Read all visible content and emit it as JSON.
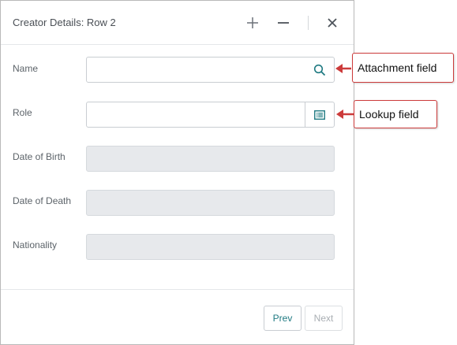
{
  "dialog": {
    "title": "Creator Details: Row 2",
    "header_buttons": [
      "add-icon",
      "minimize-icon",
      "close-icon"
    ]
  },
  "form": {
    "fields": [
      {
        "label": "Name",
        "value": "",
        "icon": "search-icon",
        "state": "editable"
      },
      {
        "label": "Role",
        "value": "",
        "icon": "list-icon",
        "state": "editable"
      },
      {
        "label": "Date of Birth",
        "value": "",
        "state": "disabled"
      },
      {
        "label": "Date of Death",
        "value": "",
        "state": "disabled"
      },
      {
        "label": "Nationality",
        "value": "",
        "state": "disabled"
      }
    ]
  },
  "footer": {
    "prev_label": "Prev",
    "next_label": "Next"
  },
  "annotations": [
    {
      "text": "Attachment field",
      "points_to": "Name"
    },
    {
      "text": "Lookup field",
      "points_to": "Role"
    }
  ],
  "colors": {
    "accent": "#1f7a82",
    "callout_border": "#cc3b3b",
    "disabled_field": "#e7e9ec"
  }
}
